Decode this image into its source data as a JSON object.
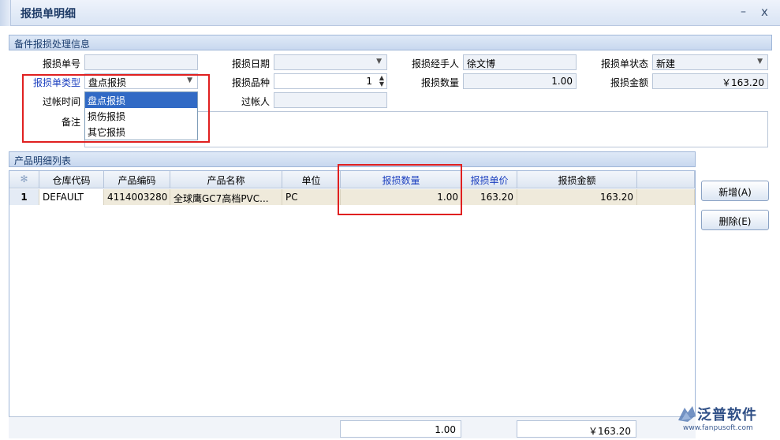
{
  "window": {
    "title": "报损单明细",
    "minimize": "–",
    "close": "x"
  },
  "section1": {
    "title": "备件报损处理信息",
    "labels": {
      "doc_no": "报损单号",
      "date": "报损日期",
      "handler": "报损经手人",
      "status": "报损单状态",
      "type": "报损单类型",
      "variety": "报损品种",
      "quantity": "报损数量",
      "amount": "报损金额",
      "post_time": "过帐时间",
      "poster": "过帐人",
      "remark": "备注"
    },
    "values": {
      "doc_no": "",
      "date": "",
      "handler": "徐文博",
      "status": "新建",
      "type": "盘点报损",
      "variety": "1",
      "quantity": "1.00",
      "amount": "￥163.20",
      "post_time": "",
      "poster": "",
      "remark": ""
    },
    "type_options": [
      "盘点报损",
      "损伤报损",
      "其它报损"
    ]
  },
  "section2": {
    "title": "产品明细列表",
    "columns": [
      "仓库代码",
      "产品编码",
      "产品名称",
      "单位",
      "报损数量",
      "报损单价",
      "报损金额"
    ],
    "rows": [
      {
        "index": "1",
        "warehouse": "DEFAULT",
        "code": "4114003280",
        "name": "全球鹰GC7高档PVC...",
        "unit": "PC",
        "qty": "1.00",
        "price": "163.20",
        "amount": "163.20"
      }
    ],
    "summary": {
      "qty": "1.00",
      "amount": "￥163.20"
    }
  },
  "buttons": {
    "add": "新增(A)",
    "delete": "删除(E)"
  },
  "logo": {
    "name": "泛普软件",
    "url": "www.fanpusoft.com"
  },
  "colors": {
    "accent": "#316ac5",
    "annotation": "#e02020",
    "label_blue": "#1b3fbf"
  }
}
